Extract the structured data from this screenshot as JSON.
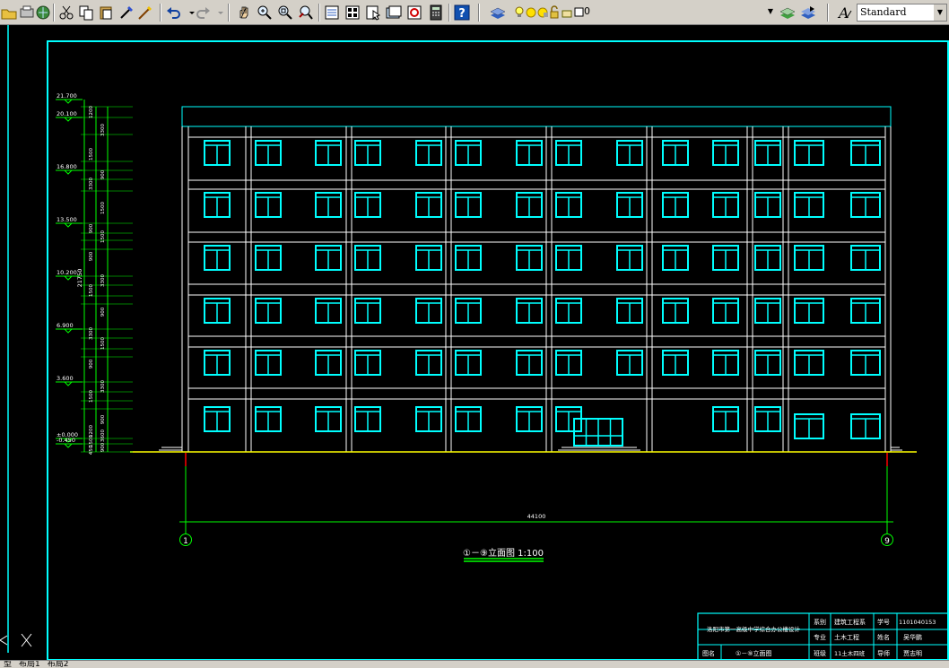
{
  "toolbar": {
    "layer_value": "0",
    "text_style_value": "Standard"
  },
  "tabs": [
    "型",
    "布局1",
    "布局2"
  ],
  "drawing": {
    "elevations": [
      "21.700",
      "20.100",
      "16.800",
      "13.500",
      "10.200",
      "6.900",
      "3.600",
      "±0.000",
      "-0.450"
    ],
    "heights": [
      "1200",
      "3300",
      "1500",
      "900",
      "3300",
      "1500",
      "900",
      "1500",
      "900",
      "3300",
      "1500",
      "900",
      "3300",
      "1500",
      "900",
      "3300",
      "1500",
      "900",
      "1200",
      "3600",
      "1500",
      "900",
      "450"
    ],
    "total_height_label": "21750",
    "dimension_label": "44100",
    "axis_left": "1",
    "axis_right": "9",
    "view_title": "①－⑨立面图 1:100"
  },
  "titleblock": {
    "project": "洛阳市第一高级中学综合办公楼设计",
    "row1_a_label": "系别",
    "row1_a_value": "建筑工程系",
    "row1_b_label": "学号",
    "row1_b_value": "1101040153",
    "row2_a_label": "专业",
    "row2_a_value": "土木工程",
    "row2_b_label": "姓名",
    "row2_b_value": "吴华鹏",
    "row3_name_label": "图名",
    "row3_name_value": "①－⑨立面图",
    "row3_a_label": "班级",
    "row3_a_value": "11土木四班",
    "row3_b_label": "导师",
    "row3_b_value": "贾志明"
  },
  "colors": {
    "frame": "#00ffff",
    "window": "#00ffff",
    "wall": "#ffffff",
    "dimension": "#00ff00",
    "ground": "#ffff00",
    "axis": "#ff0000",
    "text": "#ffffff"
  }
}
